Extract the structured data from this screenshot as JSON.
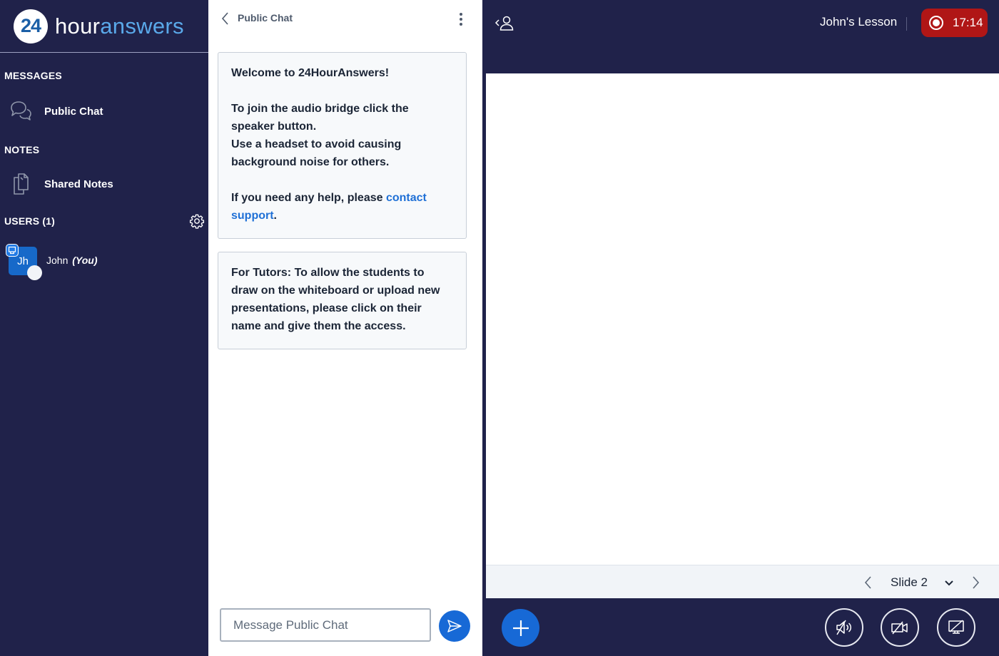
{
  "brand": {
    "logo_number": "24",
    "name_part1": "hour",
    "name_part2": "answers",
    "colors": {
      "number": "#1b5fa6",
      "part2": "#5aa9ea"
    }
  },
  "sidebar": {
    "messages_title": "MESSAGES",
    "public_chat_label": "Public Chat",
    "notes_title": "NOTES",
    "shared_notes_label": "Shared Notes",
    "users_title": "USERS (1)",
    "users": [
      {
        "initials": "Jh",
        "name": "John",
        "suffix": "(You)",
        "role": "presenter",
        "avatar_color": "#1769c9"
      }
    ]
  },
  "chat": {
    "title": "Public Chat",
    "messages": [
      {
        "welcome_prefix": "Welcome to ",
        "welcome_brand": "24HourAnswers",
        "welcome_suffix": "!",
        "line1": "To join the audio bridge click the speaker button.",
        "line2": "Use a headset to avoid causing background noise for others.",
        "help_prefix": "If you need any help, please ",
        "help_link": "contact support",
        "help_suffix": "."
      },
      {
        "text": "For Tutors: To allow the students to draw on the whiteboard or upload new presentations, please click on their name and give them the access."
      }
    ],
    "input_placeholder": "Message Public Chat",
    "input_value": ""
  },
  "main": {
    "meeting_title": "John's Lesson",
    "recording": {
      "active": true,
      "time": "17:14",
      "color": "#b01616"
    },
    "slide": {
      "current_label": "Slide 2"
    }
  },
  "colors": {
    "navy": "#20224a",
    "primary": "#1769d6",
    "link": "#1f70d6"
  }
}
